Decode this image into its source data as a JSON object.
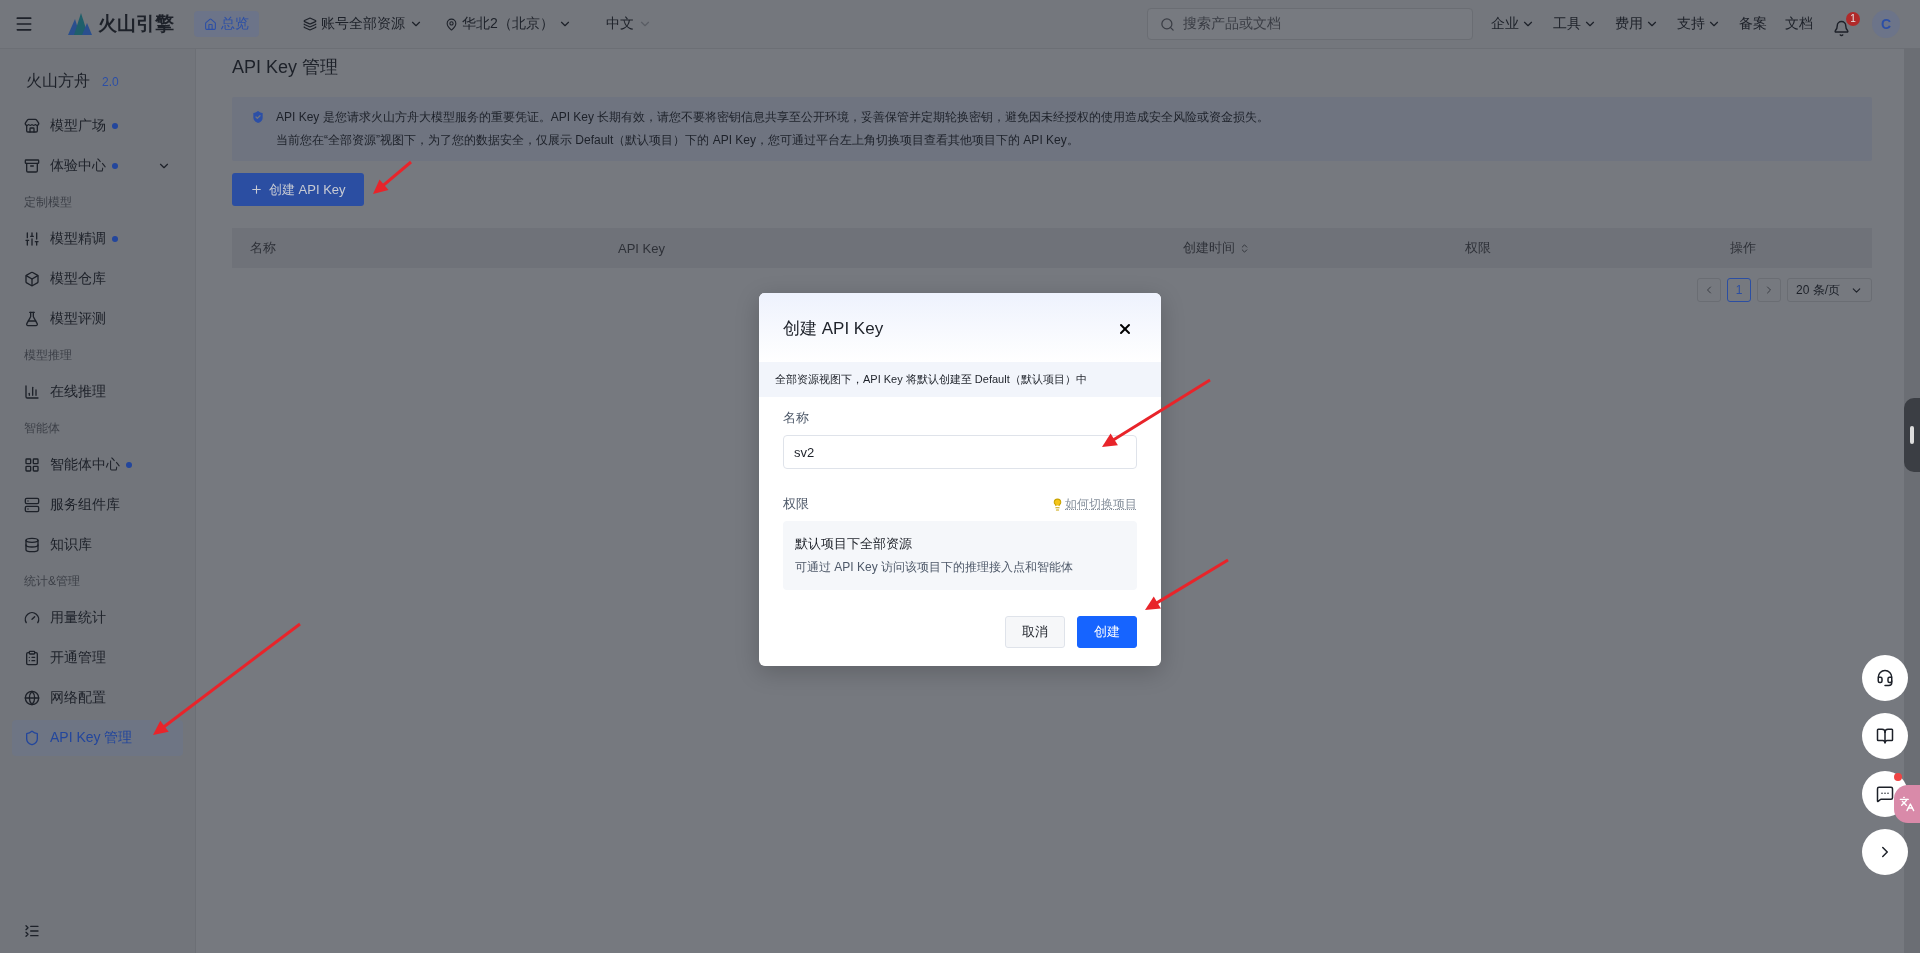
{
  "top_bar": {
    "logo_text": "火山引擎",
    "home_tab": "总览",
    "scope": "账号全部资源",
    "region": "华北2（北京）",
    "language": "中文",
    "search": {
      "placeholder": "搜索产品或文档"
    },
    "nav": [
      {
        "label": "企业",
        "dropdown": true
      },
      {
        "label": "工具",
        "dropdown": true
      },
      {
        "label": "费用",
        "dropdown": true
      },
      {
        "label": "支持",
        "dropdown": true
      },
      {
        "label": "备案",
        "dropdown": false
      },
      {
        "label": "文档",
        "dropdown": false
      }
    ],
    "notification_count": "1",
    "avatar": "C"
  },
  "sidebar": {
    "title": "火山方舟",
    "version": "2.0",
    "groups": [
      {
        "items": [
          {
            "label": "模型广场",
            "dot": true,
            "expandable": false,
            "selected": false
          },
          {
            "label": "体验中心",
            "dot": true,
            "expandable": true,
            "selected": false
          }
        ]
      },
      {
        "heading": "定制模型",
        "items": [
          {
            "label": "模型精调",
            "dot": true,
            "expandable": false,
            "selected": false
          },
          {
            "label": "模型仓库",
            "dot": false,
            "expandable": false,
            "selected": false
          },
          {
            "label": "模型评测",
            "dot": false,
            "expandable": false,
            "selected": false
          }
        ]
      },
      {
        "heading": "模型推理",
        "items": [
          {
            "label": "在线推理",
            "dot": false,
            "expandable": false,
            "selected": false
          }
        ]
      },
      {
        "heading": "智能体",
        "items": [
          {
            "label": "智能体中心",
            "dot": true,
            "expandable": false,
            "selected": false
          },
          {
            "label": "服务组件库",
            "dot": false,
            "expandable": false,
            "selected": false
          },
          {
            "label": "知识库",
            "dot": false,
            "expandable": false,
            "selected": false
          }
        ]
      },
      {
        "heading": "统计&管理",
        "items": [
          {
            "label": "用量统计",
            "dot": false,
            "expandable": false,
            "selected": false
          },
          {
            "label": "开通管理",
            "dot": false,
            "expandable": false,
            "selected": false
          },
          {
            "label": "网络配置",
            "dot": false,
            "expandable": false,
            "selected": false
          },
          {
            "label": "API Key 管理",
            "dot": false,
            "expandable": false,
            "selected": true
          }
        ]
      }
    ]
  },
  "main": {
    "title": "API Key 管理",
    "notice": [
      "API Key 是您请求火山方舟大模型服务的重要凭证。API Key 长期有效，请您不要将密钥信息共享至公开环境，妥善保管并定期轮换密钥，避免因未经授权的使用造成安全风险或资金损失。",
      "当前您在“全部资源”视图下，为了您的数据安全，仅展示 Default（默认项目）下的 API Key，您可通过平台左上角切换项目查看其他项目下的 API Key。"
    ],
    "create_button": "创建 API Key",
    "table": {
      "columns": [
        {
          "label": "名称",
          "sortable": false
        },
        {
          "label": "API Key",
          "sortable": false
        },
        {
          "label": "创建时间",
          "sortable": true
        },
        {
          "label": "权限",
          "sortable": false
        },
        {
          "label": "操作",
          "sortable": false
        }
      ]
    },
    "pagination": {
      "pages": [
        {
          "label": "1",
          "selected": true
        }
      ],
      "page_size": "20 条/页"
    }
  },
  "dialog": {
    "title": "创建 API Key",
    "notice": "全部资源视图下，API Key 将默认创建至 Default（默认项目）中",
    "name_label": "名称",
    "name_value": "sv2",
    "permission_label": "权限",
    "help_link": "如何切换项目",
    "permission_title": "默认项目下全部资源",
    "permission_desc": "可通过 API Key 访问该项目下的推理接入点和智能体",
    "cancel_button": "取消",
    "create_button": "创建"
  },
  "float_buttons": [
    {
      "kind": "support",
      "badge": false
    },
    {
      "kind": "docs",
      "badge": false
    },
    {
      "kind": "message",
      "badge": true
    },
    {
      "kind": "expand",
      "badge": false
    }
  ]
}
